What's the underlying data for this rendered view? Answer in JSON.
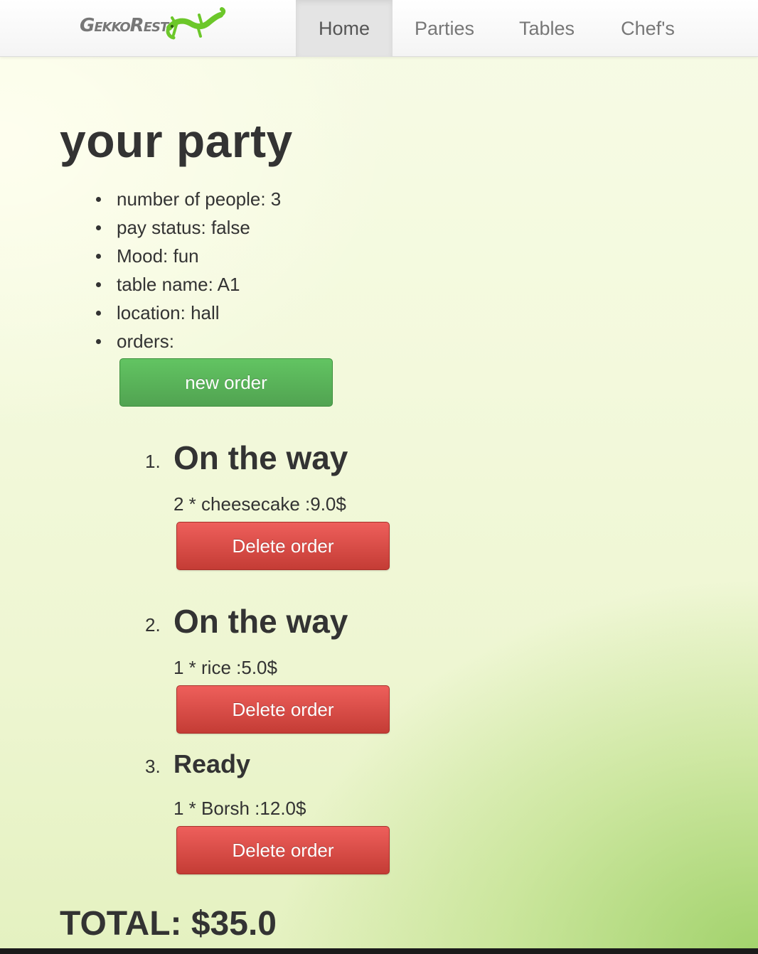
{
  "navbar": {
    "brand": "GekkoRest",
    "items": [
      {
        "label": "Home",
        "active": true
      },
      {
        "label": "Parties",
        "active": false
      },
      {
        "label": "Tables",
        "active": false
      },
      {
        "label": "Chef's",
        "active": false
      }
    ]
  },
  "party": {
    "title": "your party",
    "details": [
      "number of people: 3",
      "pay status: false",
      "Mood: fun",
      "table name: A1",
      "location: hall",
      "orders:"
    ],
    "new_order_label": "new order",
    "orders": [
      {
        "number": "1.",
        "status": "On the way",
        "item": "2 * cheesecake :9.0$",
        "delete_label": "Delete order"
      },
      {
        "number": "2.",
        "status": "On the way",
        "item": "1 * rice :5.0$",
        "delete_label": "Delete order"
      },
      {
        "number": "3.",
        "status": "Ready",
        "item": "1 * Borsh :12.0$",
        "delete_label": "Delete order"
      }
    ],
    "total": "TOTAL: $35.0"
  },
  "colors": {
    "success": "#51a351",
    "danger": "#c43c35",
    "gecko": "#6cc72a"
  }
}
